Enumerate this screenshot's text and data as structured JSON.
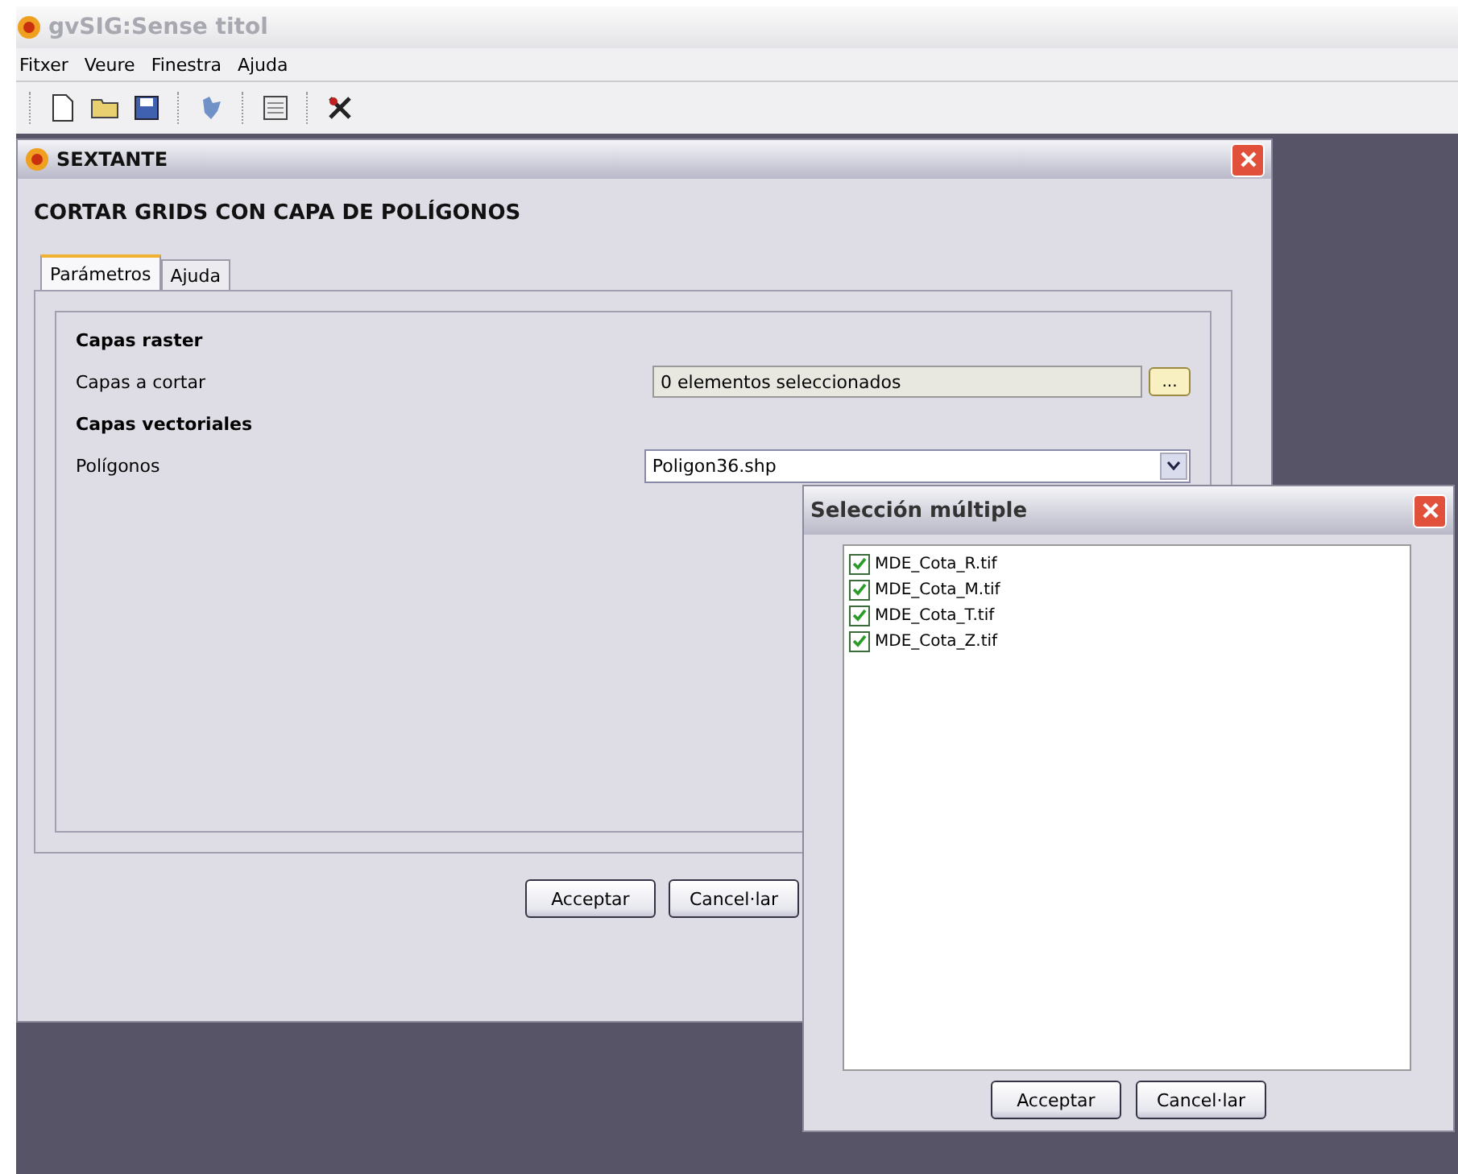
{
  "window": {
    "title": "gvSIG:Sense titol"
  },
  "menu": [
    "Fitxer",
    "Veure",
    "Finestra",
    "Ajuda"
  ],
  "sextante": {
    "title": "SEXTANTE",
    "heading": "CORTAR GRIDS CON CAPA DE POLÍGONOS",
    "tabs": [
      {
        "label": "Parámetros",
        "selected": true
      },
      {
        "label": "Ajuda",
        "selected": false
      }
    ],
    "params": [
      {
        "kind": "section",
        "label": "Capas raster"
      },
      {
        "kind": "multi",
        "label": "Capas a cortar",
        "value": "0 elementos seleccionados",
        "button": "..."
      },
      {
        "kind": "section",
        "label": "Capas vectoriales"
      },
      {
        "kind": "combo",
        "label": "Polígonos",
        "value": "Poligon36.shp"
      }
    ],
    "buttons": [
      "Acceptar",
      "Cancel·lar"
    ]
  },
  "dialog": {
    "title": "Selección múltiple",
    "items": [
      {
        "label": "MDE_Cota_R.tif",
        "checked": true
      },
      {
        "label": "MDE_Cota_M.tif",
        "checked": true
      },
      {
        "label": "MDE_Cota_T.tif",
        "checked": true
      },
      {
        "label": "MDE_Cota_Z.tif",
        "checked": true
      }
    ],
    "buttons": [
      "Acceptar",
      "Cancel·lar"
    ]
  }
}
